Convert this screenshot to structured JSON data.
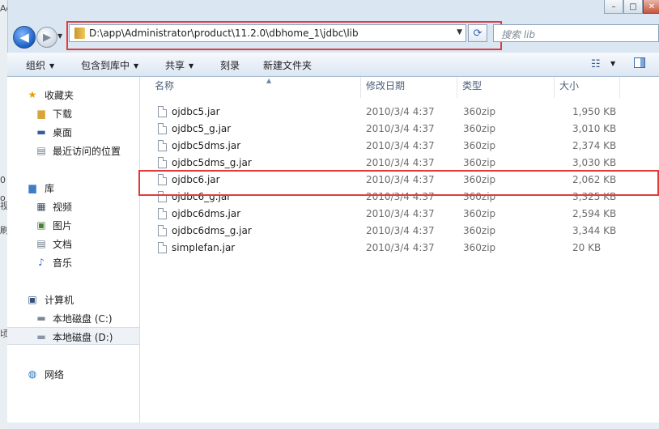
{
  "window": {
    "caption_min": "–",
    "caption_max": "□"
  },
  "left_strip": [
    "Ac",
    "0",
    "o",
    "视",
    "刷",
    "顷"
  ],
  "nav": {
    "back_glyph": "◀",
    "forward_glyph": "▶",
    "address": "D:\\app\\Administrator\\product\\11.2.0\\dbhome_1\\jdbc\\lib",
    "search_placeholder": "搜索 lib"
  },
  "toolbar": {
    "organize": "组织",
    "include_in_library": "包含到库中",
    "share": "共享",
    "burn": "刻录",
    "new_folder": "新建文件夹"
  },
  "sidebar": {
    "favorites": "收藏夹",
    "downloads": "下载",
    "desktop": "桌面",
    "recent": "最近访问的位置",
    "libraries": "库",
    "videos": "视频",
    "pictures": "图片",
    "documents": "文档",
    "music": "音乐",
    "computer": "计算机",
    "drive_c": "本地磁盘 (C:)",
    "drive_d": "本地磁盘 (D:)",
    "network": "网络"
  },
  "columns": {
    "name": "名称",
    "modified": "修改日期",
    "type": "类型",
    "size": "大小"
  },
  "files": [
    {
      "name": "ojdbc5.jar",
      "modified": "2010/3/4 4:37",
      "type": "360zip",
      "size": "1,950 KB"
    },
    {
      "name": "ojdbc5_g.jar",
      "modified": "2010/3/4 4:37",
      "type": "360zip",
      "size": "3,010 KB"
    },
    {
      "name": "ojdbc5dms.jar",
      "modified": "2010/3/4 4:37",
      "type": "360zip",
      "size": "2,374 KB"
    },
    {
      "name": "ojdbc5dms_g.jar",
      "modified": "2010/3/4 4:37",
      "type": "360zip",
      "size": "3,030 KB"
    },
    {
      "name": "ojdbc6.jar",
      "modified": "2010/3/4 4:37",
      "type": "360zip",
      "size": "2,062 KB"
    },
    {
      "name": "ojdbc6_g.jar",
      "modified": "2010/3/4 4:37",
      "type": "360zip",
      "size": "3,325 KB"
    },
    {
      "name": "ojdbc6dms.jar",
      "modified": "2010/3/4 4:37",
      "type": "360zip",
      "size": "2,594 KB"
    },
    {
      "name": "ojdbc6dms_g.jar",
      "modified": "2010/3/4 4:37",
      "type": "360zip",
      "size": "3,344 KB"
    },
    {
      "name": "simplefan.jar",
      "modified": "2010/3/4 4:37",
      "type": "360zip",
      "size": "20 KB"
    }
  ],
  "colors": {
    "highlight": "#e03c3c",
    "accent": "#2a63b5"
  }
}
